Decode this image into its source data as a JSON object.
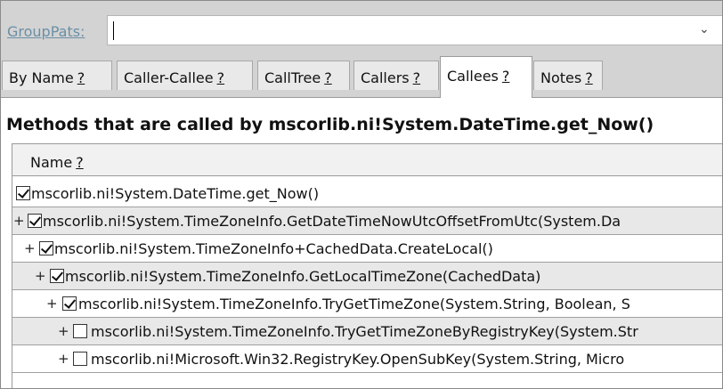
{
  "grouppats": {
    "label": "GroupPats:",
    "value": ""
  },
  "tabs": [
    {
      "label": "By Name",
      "help": "?"
    },
    {
      "label": "Caller-Callee",
      "help": "?"
    },
    {
      "label": "CallTree",
      "help": "?"
    },
    {
      "label": "Callers",
      "help": "?"
    },
    {
      "label": "Callees",
      "help": "?",
      "active": true
    },
    {
      "label": "Notes",
      "help": "?"
    }
  ],
  "heading": "Methods that are called by mscorlib.ni!System.DateTime.get_Now()",
  "grid": {
    "column_header": {
      "label": "Name",
      "help": "?"
    },
    "rows": [
      {
        "expander": "",
        "checked": true,
        "text": "mscorlib.ni!System.DateTime.get_Now()"
      },
      {
        "expander": "+",
        "checked": true,
        "text": "mscorlib.ni!System.TimeZoneInfo.GetDateTimeNowUtcOffsetFromUtc(System.Da"
      },
      {
        "expander": "+",
        "checked": true,
        "text": "mscorlib.ni!System.TimeZoneInfo+CachedData.CreateLocal()"
      },
      {
        "expander": "+",
        "checked": true,
        "text": "mscorlib.ni!System.TimeZoneInfo.GetLocalTimeZone(CachedData)"
      },
      {
        "expander": "+",
        "checked": true,
        "text": "mscorlib.ni!System.TimeZoneInfo.TryGetTimeZone(System.String, Boolean, S"
      },
      {
        "expander": "+",
        "checked": false,
        "text": "mscorlib.ni!System.TimeZoneInfo.TryGetTimeZoneByRegistryKey(System.Str"
      },
      {
        "expander": "+",
        "checked": false,
        "text": "mscorlib.ni!Microsoft.Win32.RegistryKey.OpenSubKey(System.String, Micro"
      }
    ]
  }
}
